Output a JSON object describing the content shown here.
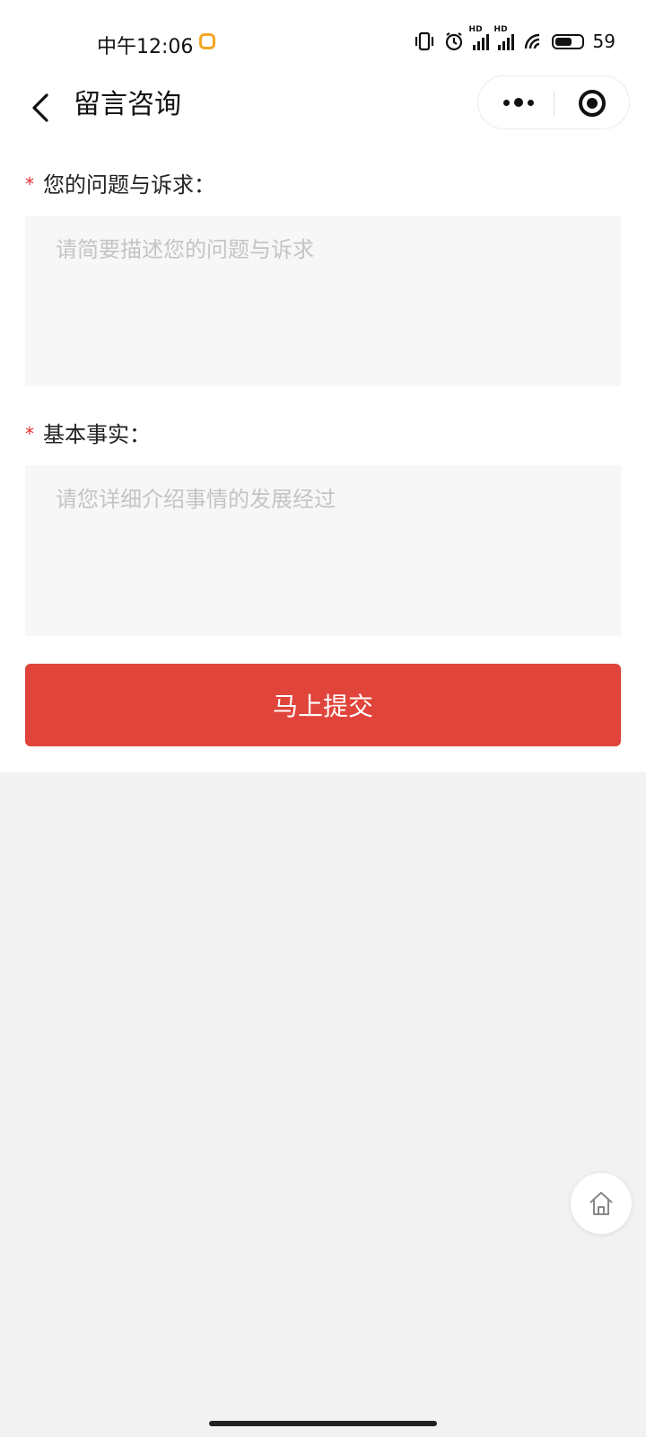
{
  "status_bar": {
    "time": "中午12:06",
    "battery": "59",
    "hd_label": "HD"
  },
  "nav": {
    "title": "留言咨询"
  },
  "form": {
    "question": {
      "required_mark": "*",
      "label": "您的问题与诉求：",
      "placeholder": "请简要描述您的问题与诉求",
      "value": ""
    },
    "facts": {
      "required_mark": "*",
      "label": "基本事实：",
      "placeholder": "请您详细介绍事情的发展经过",
      "value": ""
    },
    "submit_label": "马上提交"
  },
  "colors": {
    "accent": "#e0443a",
    "required": "#e0312f",
    "notification": "#f5a623"
  }
}
